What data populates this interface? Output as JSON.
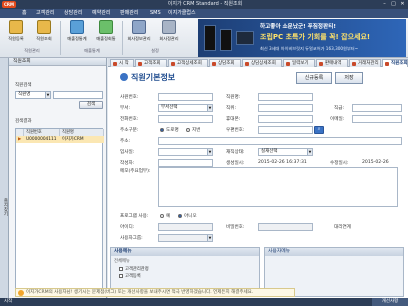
{
  "app": {
    "title": "이지가 CRM Standard - 직원조회",
    "window_buttons": [
      "–",
      "□",
      "✕"
    ],
    "logo_text": "CRM"
  },
  "menu": [
    "홈",
    "고객관리",
    "상담관리",
    "예약관리",
    "판매관리",
    "SMS",
    "이지가클럽스"
  ],
  "ribbon": {
    "buttons": [
      {
        "label": "직원등록",
        "icon": "user-add-icon"
      },
      {
        "label": "직원조회",
        "icon": "user-search-icon"
      },
      {
        "label": "매출정통계",
        "icon": "chart-icon"
      },
      {
        "label": "매출정회통",
        "icon": "chart-bar-icon"
      },
      {
        "label": "회사정보관리",
        "icon": "building-icon"
      },
      {
        "label": "회사정관리",
        "icon": "settings-icon"
      }
    ],
    "groups": [
      "직원관리",
      "매출통계",
      "설정"
    ]
  },
  "banner": {
    "line1": "하고좋아 소문났군! 푸짐정판티!",
    "line2": "조립PC 초특가 기회를 꼭! 잡으세요!",
    "line3": "최신 3세대 아이비브릿지 듀얼코어가 163,300원부터~"
  },
  "tabs": [
    {
      "label": "시 작",
      "active": false
    },
    {
      "label": "고객조회",
      "active": false
    },
    {
      "label": "고객상세조회",
      "active": false
    },
    {
      "label": "상담조회",
      "active": false
    },
    {
      "label": "상담상세조회",
      "active": false
    },
    {
      "label": "일력보기",
      "active": false
    },
    {
      "label": "판매내역",
      "active": false
    },
    {
      "label": "거래처관리",
      "active": false
    },
    {
      "label": "직원조회",
      "active": true
    }
  ],
  "sidebar": {
    "header": "직원조회",
    "search_label": "직원검색",
    "search_type": "직원명",
    "search_value": "",
    "search_button": "검색",
    "result_label": "검색결과",
    "columns": [
      "직원번호",
      "직원명"
    ],
    "rows": [
      {
        "id": "U0000004111",
        "name": "이지가CRM"
      }
    ],
    "leftbar_label": "즐겨찾기"
  },
  "form": {
    "title": "직원기본정보",
    "new_button": "신규등록",
    "save_button": "저장",
    "labels": {
      "emp_no": "사원번호:",
      "emp_name": "직원명:",
      "dept": "부서:",
      "position": "직위:",
      "rank": "직급:",
      "phone": "전화번호:",
      "mobile": "휴대폰:",
      "email": "이메일:",
      "addr_type": "주소구분:",
      "zip": "우편번호:",
      "addr": "주소:",
      "join_date": "입사일:",
      "status": "재직상태:",
      "creator": "작성자:",
      "created": "생성일시:",
      "modified": "수정일시:",
      "memo": "메모(주요업무):",
      "program_use": "프로그램 사용:",
      "user_id": "아이디:",
      "password": "비밀번호:",
      "rep_person": "대리연계",
      "user_group": "사용자그룹:"
    },
    "values": {
      "dept": "부서선택",
      "addr_radio1": "도로명",
      "addr_radio2": "지번",
      "status": "실재선택",
      "created": "2015-02-26 16:37:31",
      "modified": "2015-02-26",
      "program_use_yes": "예",
      "program_use_no": "아니오"
    },
    "user_menu_title": "사용메뉴",
    "user_menu_hint": "전체메뉴",
    "user_menu_items": [
      "고객관리관정",
      "고객등록"
    ],
    "user_perm_title": "사용자메뉴"
  },
  "notice": "이지가CRM의 사용자님! 생기시는 문제점(버그) 또는 개선사항을 보내주시면 적극 반영하겠습니다. 언제든지 해결주세요.",
  "status": {
    "left": "시작",
    "right": "개선사항",
    "message": ""
  }
}
